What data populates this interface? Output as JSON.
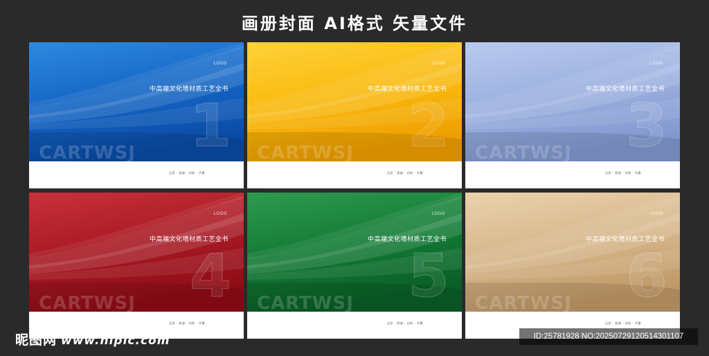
{
  "page": {
    "title": "画册封面 AI格式 矢量文件"
  },
  "cards": [
    {
      "logo": "LOGO",
      "headline": "中高端文化墙材质工艺全书",
      "number": "1",
      "brand": "CARTWSJ",
      "footer": "品质 · 超越 · 创新 · 共赢",
      "colors": {
        "light": "#2e8ae0",
        "mid": "#1465c4",
        "dark": "#0a4aa4"
      }
    },
    {
      "logo": "LOGO",
      "headline": "中高端文化墙材质工艺全书",
      "number": "2",
      "brand": "CARTWSJ",
      "footer": "品质 · 超越 · 创新 · 共赢",
      "colors": {
        "light": "#ffd23a",
        "mid": "#f9b90d",
        "dark": "#ee9e00"
      }
    },
    {
      "logo": "LOGO",
      "headline": "中高端文化墙材质工艺全书",
      "number": "3",
      "brand": "CARTWSJ",
      "footer": "品质 · 超越 · 创新 · 共赢",
      "colors": {
        "light": "#b9caef",
        "mid": "#9bb0df",
        "dark": "#8197cf"
      }
    },
    {
      "logo": "LOGO",
      "headline": "中高端文化墙材质工艺全书",
      "number": "4",
      "brand": "CARTWSJ",
      "footer": "品质 · 超越 · 创新 · 共赢",
      "colors": {
        "light": "#c8303a",
        "mid": "#a81a24",
        "dark": "#8e0c16"
      }
    },
    {
      "logo": "LOGO",
      "headline": "中高端文化墙材质工艺全书",
      "number": "5",
      "brand": "CARTWSJ",
      "footer": "品质 · 超越 · 创新 · 共赢",
      "colors": {
        "light": "#2e9a50",
        "mid": "#137a35",
        "dark": "#0a5e26"
      }
    },
    {
      "logo": "LOGO",
      "headline": "中高端文化墙材质工艺全书",
      "number": "6",
      "brand": "CARTWSJ",
      "footer": "品质 · 超越 · 创新 · 共赢",
      "colors": {
        "light": "#ead2ae",
        "mid": "#d6b68a",
        "dark": "#bf9866"
      }
    }
  ],
  "watermark": {
    "site_name": "昵图网",
    "site_url": "www.nipic.com",
    "id_text": "ID:25781928 NO:20250729120514301107"
  }
}
